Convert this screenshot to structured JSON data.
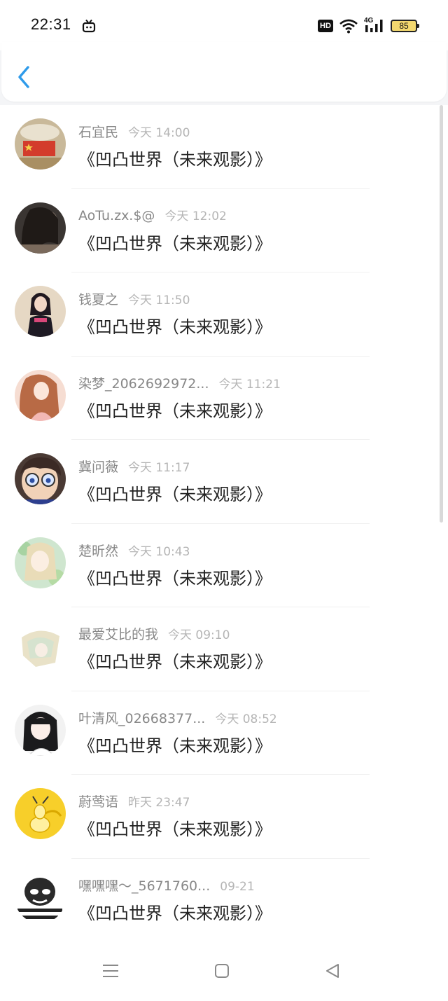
{
  "status_bar": {
    "time": "22:31",
    "hd": "HD",
    "network": "4G",
    "battery": "85"
  },
  "header": {
    "back_icon": "chevron-left-icon",
    "accent": "#2f9bea"
  },
  "items": [
    {
      "user": "石宜民",
      "time": "今天 14:00",
      "title": "《凹凸世界（未来观影）》"
    },
    {
      "user": "AoTu.zx.$@",
      "time": "今天 12:02",
      "title": "《凹凸世界（未来观影）》"
    },
    {
      "user": "钱夏之",
      "time": "今天 11:50",
      "title": "《凹凸世界（未来观影）》"
    },
    {
      "user": "染梦_2062692972...",
      "time": "今天 11:21",
      "title": "《凹凸世界（未来观影）》"
    },
    {
      "user": "冀问薇",
      "time": "今天 11:17",
      "title": "《凹凸世界（未来观影）》"
    },
    {
      "user": "楚昕然",
      "time": "今天 10:43",
      "title": "《凹凸世界（未来观影）》"
    },
    {
      "user": "最爱艾比的我",
      "time": "今天 09:10",
      "title": "《凹凸世界（未来观影）》"
    },
    {
      "user": "叶清风_02668377...",
      "time": "今天 08:52",
      "title": "《凹凸世界（未来观影）》"
    },
    {
      "user": "蔚莺语",
      "time": "昨天 23:47",
      "title": "《凹凸世界（未来观影）》"
    },
    {
      "user": "嘿嘿嘿～_5671760...",
      "time": "09-21",
      "title": "《凹凸世界（未来观影）》"
    }
  ],
  "nav_bar": {
    "menu_icon": "menu-icon",
    "home_icon": "home-icon",
    "back_icon": "back-triangle-icon"
  }
}
